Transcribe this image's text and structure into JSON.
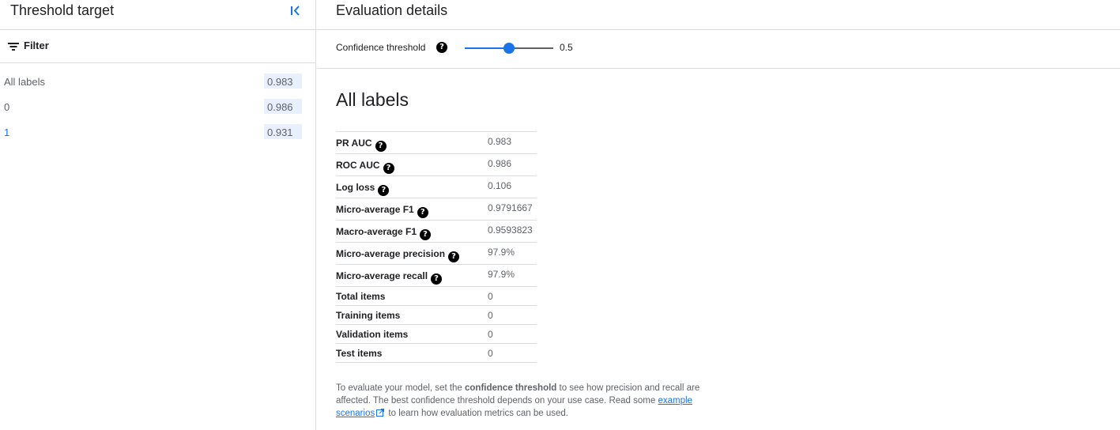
{
  "left_panel": {
    "title": "Threshold target",
    "collapse_icon": "collapse-left-icon",
    "filter_label": "Filter",
    "labels": [
      {
        "name": "All labels",
        "score": "0.983"
      },
      {
        "name": "0",
        "score": "0.986"
      },
      {
        "name": "1",
        "score": "0.931"
      }
    ]
  },
  "right_panel": {
    "title": "Evaluation details",
    "threshold": {
      "label": "Confidence threshold",
      "value": "0.5",
      "level": 0.5
    },
    "section_title": "All labels",
    "metrics": [
      {
        "name": "PR AUC",
        "value": "0.983",
        "help": true
      },
      {
        "name": "ROC AUC",
        "value": "0.986",
        "help": true
      },
      {
        "name": "Log loss",
        "value": "0.106",
        "help": true
      },
      {
        "name": "Micro-average F1",
        "value": "0.9791667",
        "help": true
      },
      {
        "name": "Macro-average F1",
        "value": "0.9593823",
        "help": true
      },
      {
        "name": "Micro-average precision",
        "value": "97.9%",
        "help": true
      },
      {
        "name": "Micro-average recall",
        "value": "97.9%",
        "help": true
      },
      {
        "name": "Total items",
        "value": "0",
        "help": false
      },
      {
        "name": "Training items",
        "value": "0",
        "help": false
      },
      {
        "name": "Validation items",
        "value": "0",
        "help": false
      },
      {
        "name": "Test items",
        "value": "0",
        "help": false
      }
    ],
    "footnote": {
      "part1": "To evaluate your model, set the ",
      "bold": "confidence threshold",
      "part2": " to see how precision and recall are affected. The best confidence threshold depends on your use case. Read some ",
      "link": "example scenarios",
      "part3": " to learn how evaluation metrics can be used."
    }
  },
  "colors": {
    "accent": "#1a73e8",
    "selected_bg": "#e8f0fe",
    "divider": "#dadce0",
    "muted_text": "#5f6368"
  }
}
